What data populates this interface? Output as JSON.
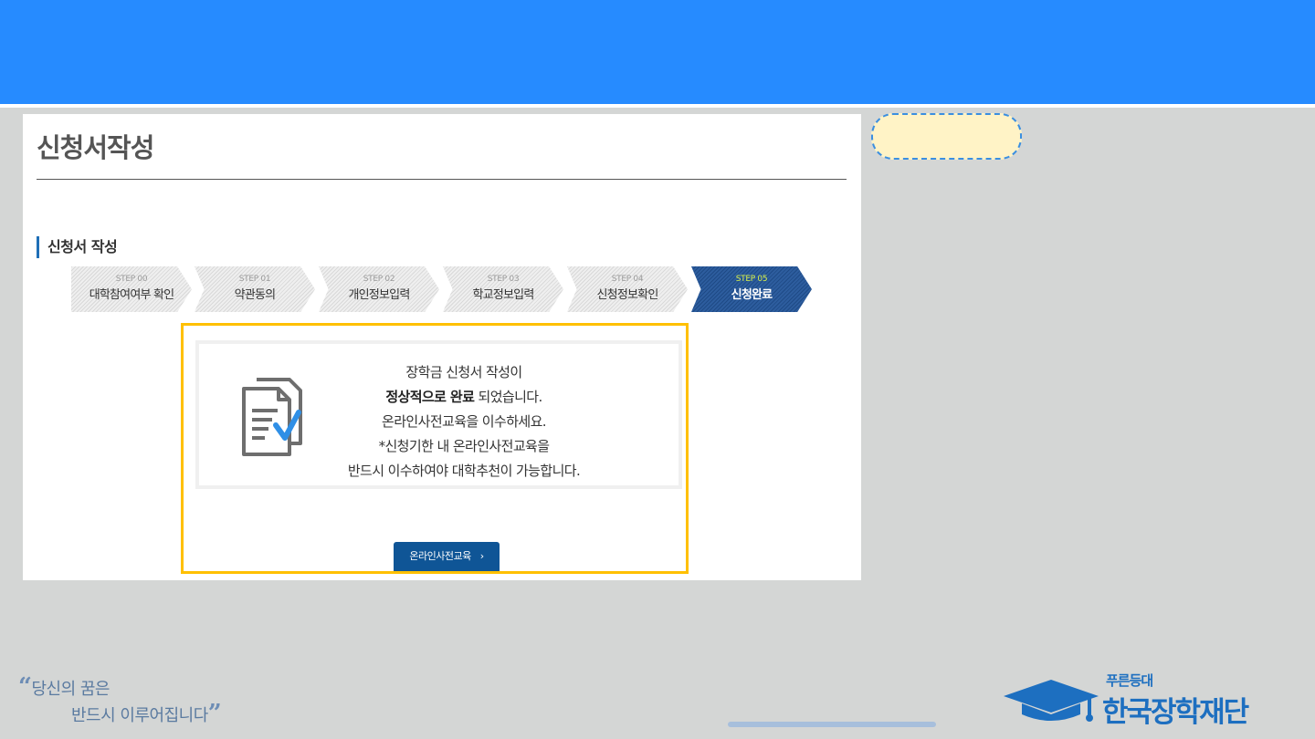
{
  "page": {
    "title": "신청서작성",
    "section_title": "신청서 작성"
  },
  "steps": [
    {
      "num": "STEP 00",
      "label": "대학참여여부 확인",
      "active": false
    },
    {
      "num": "STEP 01",
      "label": "약관동의",
      "active": false
    },
    {
      "num": "STEP 02",
      "label": "개인정보입력",
      "active": false
    },
    {
      "num": "STEP 03",
      "label": "학교정보입력",
      "active": false
    },
    {
      "num": "STEP 04",
      "label": "신청정보확인",
      "active": false
    },
    {
      "num": "STEP 05",
      "label": "신청완료",
      "active": true
    }
  ],
  "message": {
    "line1": "장학금 신청서 작성이",
    "line2_bold": "정상적으로 완료",
    "line2_rest": " 되었습니다.",
    "line3": "온라인사전교육을 이수하세요.",
    "line4": "*신청기한 내 온라인사전교육을",
    "line5": "반드시 이수하여야 대학추천이 가능합니다."
  },
  "button": {
    "label": "온라인사전교육",
    "chevron": "›"
  },
  "footer": {
    "slogan_open": "“",
    "slogan_line1": "당신의 꿈은",
    "slogan_line2": "반드시 이루어집니다",
    "slogan_close": "”",
    "logo_sub": "푸른등대",
    "logo_main": "한국장학재단"
  },
  "colors": {
    "header": "#268bff",
    "highlight": "#ffc000",
    "active_step": "#1e4a86",
    "button": "#0f5596",
    "brand": "#1d6fc0"
  },
  "icons": {
    "document_check": "document-check-icon",
    "graduation_cap": "graduation-cap-icon"
  }
}
